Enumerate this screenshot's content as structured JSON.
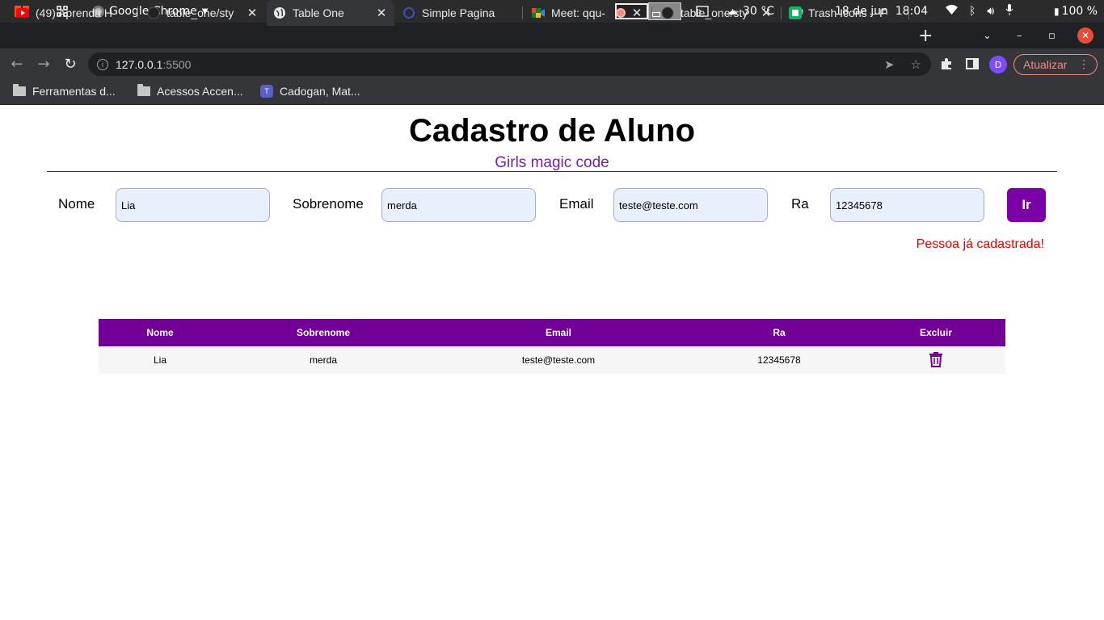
{
  "system_bar": {
    "app_name": "Google Chrome",
    "temperature": "30 °C",
    "date": "18 de jun",
    "time": "18:04",
    "battery": "100 %"
  },
  "tabs": [
    {
      "title": "(49) Aprenda H",
      "icon": "youtube-icon",
      "active": false
    },
    {
      "title": "table_one/sty",
      "icon": "github-icon",
      "active": false
    },
    {
      "title": "Table One",
      "icon": "globe-icon",
      "active": true
    },
    {
      "title": "Simple Pagina",
      "icon": "site-icon",
      "active": false
    },
    {
      "title": "Meet: qqu-",
      "icon": "meet-icon",
      "active": false
    },
    {
      "title": "table_one/sty",
      "icon": "github-icon",
      "active": false
    },
    {
      "title": "Trash Icons – F",
      "icon": "flaticon-icon",
      "active": false
    }
  ],
  "address_bar": {
    "host": "127.0.0.1",
    "port": ":5500"
  },
  "profile_initial": "D",
  "update_button": "Atualizar",
  "bookmarks": [
    {
      "label": "Ferramentas d...",
      "icon": "folder-icon"
    },
    {
      "label": "Acessos Accen...",
      "icon": "folder-icon"
    },
    {
      "label": "Cadogan, Mat...",
      "icon": "teams-icon"
    }
  ],
  "page": {
    "title": "Cadastro de Aluno",
    "subtitle": "Girls magic code",
    "form": {
      "nome_label": "Nome",
      "nome_value": "Lia",
      "sobrenome_label": "Sobrenome",
      "sobrenome_value": "merda",
      "email_label": "Email",
      "email_value": "teste@teste.com",
      "ra_label": "Ra",
      "ra_value": "12345678",
      "submit_label": "Ir"
    },
    "error_message": "Pessoa já cadastrada!",
    "table": {
      "headers": [
        "Nome",
        "Sobrenome",
        "Email",
        "Ra",
        "Excluir"
      ],
      "rows": [
        {
          "nome": "Lia",
          "sobrenome": "merda",
          "email": "teste@teste.com",
          "ra": "12345678"
        }
      ]
    }
  },
  "colors": {
    "accent_purple": "#720096",
    "subtitle_purple": "#7b1fa2",
    "error_red": "#e00000"
  }
}
